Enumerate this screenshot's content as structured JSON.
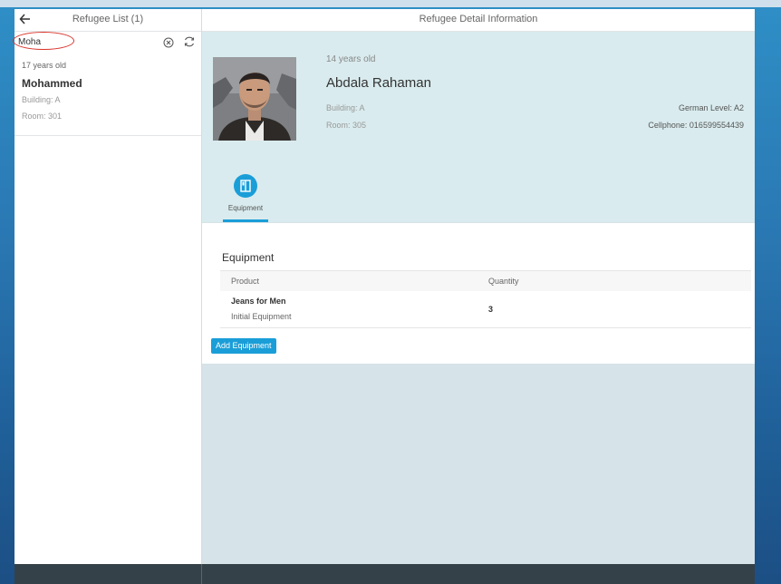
{
  "master": {
    "title": "Refugee List (1)",
    "search": {
      "value": "Moha",
      "placeholder": ""
    },
    "items": [
      {
        "age": "17 years old",
        "name": "Mohammed",
        "building": "Building: A",
        "room": "Room: 301"
      }
    ]
  },
  "detail": {
    "title": "Refugee Detail Information",
    "person": {
      "age": "14 years old",
      "name": "Abdala Rahaman",
      "building": "Building: A",
      "room": "Room: 305",
      "german_level": "German Level: A2",
      "cellphone": "Cellphone: 016599554439"
    },
    "tab": {
      "label": "Equipment",
      "icon": "book-icon"
    },
    "section": {
      "title": "Equipment",
      "columns": [
        "Product",
        "Quantity"
      ],
      "rows": [
        {
          "product": "Jeans for Men",
          "category": "Initial Equipment",
          "quantity": "3"
        }
      ],
      "add_label": "Add Equipment"
    }
  },
  "colors": {
    "accent": "#1a9ed8",
    "header_bg": "#d9ebee",
    "footer": "#354148",
    "highlight": "#d9342b"
  }
}
